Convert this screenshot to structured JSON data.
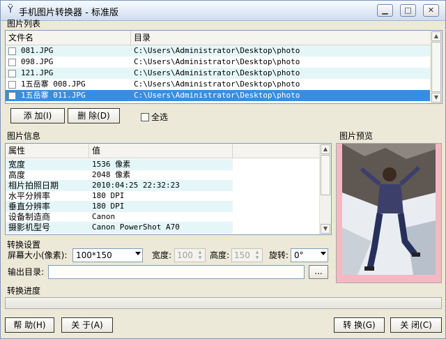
{
  "window": {
    "title": "手机图片转换器 - 标准版"
  },
  "image_list": {
    "section_label": "图片列表",
    "columns": [
      "文件名",
      "目录"
    ],
    "rows": [
      {
        "file": "081.JPG",
        "dir": "C:\\Users\\Administrator\\Desktop\\photo",
        "style": "alt"
      },
      {
        "file": "098.JPG",
        "dir": "C:\\Users\\Administrator\\Desktop\\photo",
        "style": ""
      },
      {
        "file": "121.JPG",
        "dir": "C:\\Users\\Administrator\\Desktop\\photo",
        "style": "alt"
      },
      {
        "file": "1五岳寨 008.JPG",
        "dir": "C:\\Users\\Administrator\\Desktop\\photo",
        "style": ""
      },
      {
        "file": "1五岳寨 011.JPG",
        "dir": "C:\\Users\\Administrator\\Desktop\\photo",
        "style": "sel"
      }
    ],
    "add_button": "添 加(I)",
    "delete_button": "删 除(D)",
    "select_all_label": "全选"
  },
  "image_info": {
    "section_label": "图片信息",
    "columns": [
      "属性",
      "值"
    ],
    "rows": [
      {
        "prop": "宽度",
        "value": "1536 像素"
      },
      {
        "prop": "高度",
        "value": "2048 像素"
      },
      {
        "prop": "相片拍照日期",
        "value": "2010:04:25 22:32:23"
      },
      {
        "prop": "水平分辨率",
        "value": "180 DPI"
      },
      {
        "prop": "垂直分辨率",
        "value": "180 DPI"
      },
      {
        "prop": "设备制造商",
        "value": "Canon"
      },
      {
        "prop": "摄影机型号",
        "value": "Canon PowerShot A70"
      }
    ]
  },
  "preview": {
    "section_label": "图片预览"
  },
  "convert_settings": {
    "section_label": "转换设置",
    "screen_size_label": "屏幕大小(像素):",
    "screen_size_value": "100*150",
    "width_label": "宽度:",
    "width_value": "100",
    "height_label": "高度:",
    "height_value": "150",
    "rotate_label": "旋转:",
    "rotate_value": "0°",
    "output_dir_label": "输出目录:",
    "output_dir_value": "",
    "browse_button": "..."
  },
  "progress": {
    "section_label": "转换进度",
    "value": 0
  },
  "buttons": {
    "help": "帮 助(H)",
    "about": "关 于(A)",
    "convert": "转 换(G)",
    "close": "关 闭(C)"
  },
  "icons": [
    "app-icon",
    "minimize-icon",
    "maximize-icon",
    "close-icon",
    "scroll-up-icon",
    "scroll-down-icon",
    "dropdown-arrow-icon"
  ],
  "colors": {
    "selection": "#3a8dde",
    "alt_row": "#e4f6f8",
    "preview_border": "#f4b8c2"
  }
}
